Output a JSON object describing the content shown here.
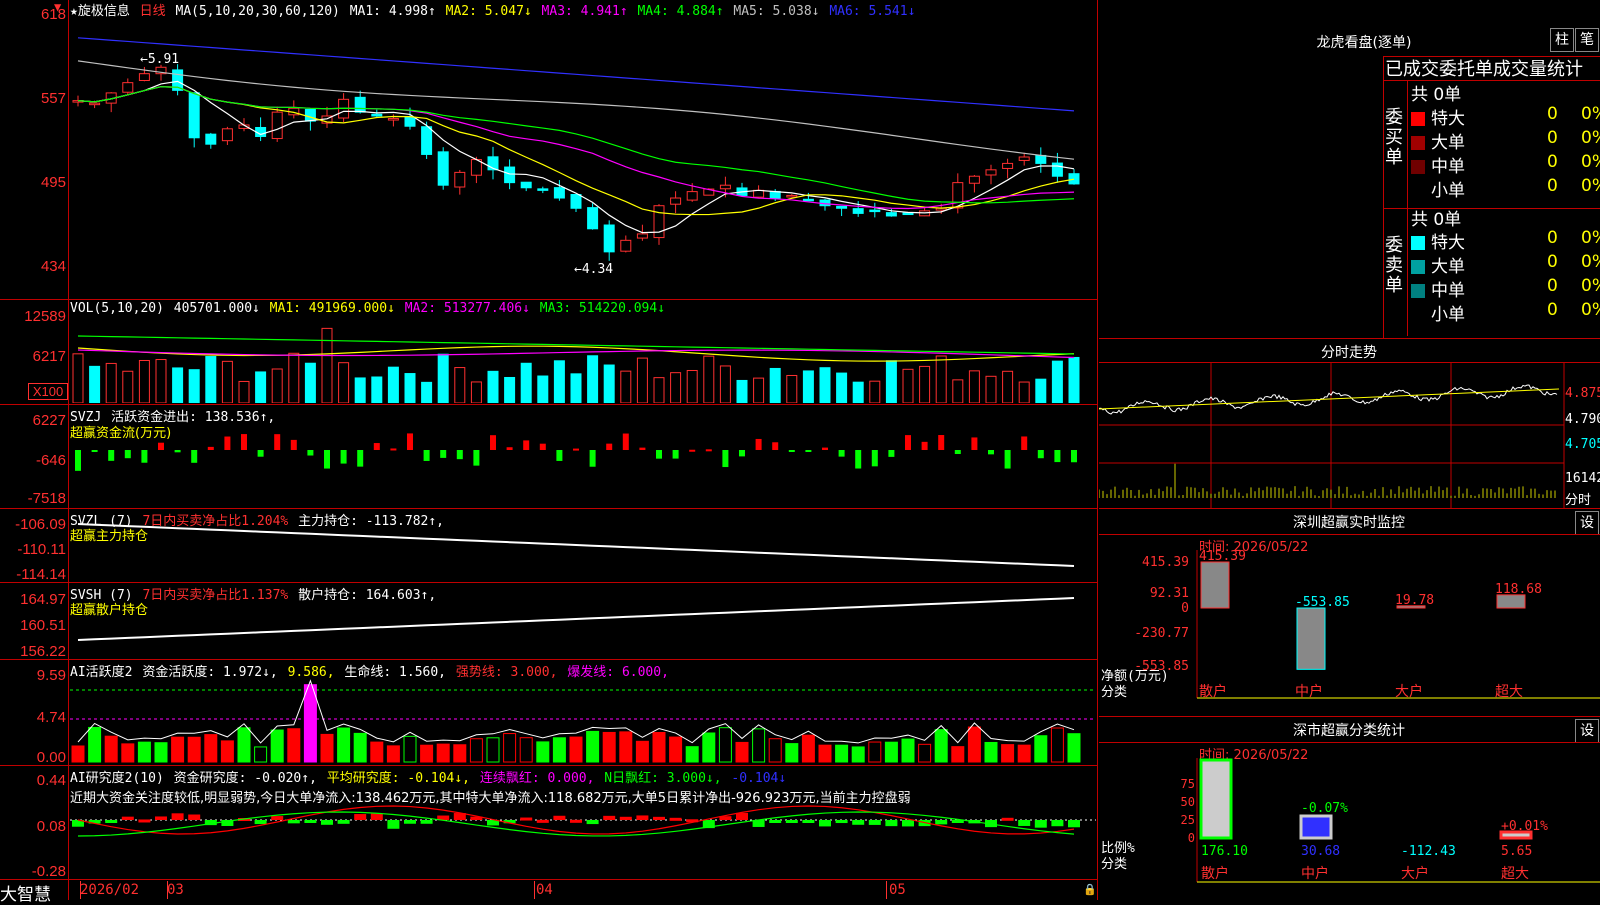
{
  "stock": {
    "name": "★旋极信息",
    "period": "日线",
    "ma_params": "MA(5,10,20,30,60,120)"
  },
  "price_header": [
    {
      "t": "MA1: 4.998↑",
      "c": "#ffffff"
    },
    {
      "t": "MA2: 5.047↓",
      "c": "#ffff00"
    },
    {
      "t": "MA3: 4.941↑",
      "c": "#ff00ff"
    },
    {
      "t": "MA4: 4.884↑",
      "c": "#00ff00"
    },
    {
      "t": "MA5: 5.038↓",
      "c": "#c0c0c0"
    },
    {
      "t": "MA6: 5.541↓",
      "c": "#0000ff"
    }
  ],
  "price_axis": [
    "618",
    "557",
    "495",
    "434"
  ],
  "price_marks": {
    "high": "5.91",
    "low": "4.34"
  },
  "vol_header": {
    "name": "VOL(5,10,20)",
    "value": "405701.000↓",
    "ma": [
      {
        "t": "MA1: 491969.000↓",
        "c": "#ffff00"
      },
      {
        "t": "MA2: 513277.406↓",
        "c": "#ff00ff"
      },
      {
        "t": "MA3: 514220.094↓",
        "c": "#00ff00"
      }
    ]
  },
  "vol_axis": [
    "12589",
    "6217",
    "X100"
  ],
  "svzj_header": {
    "name": "SVZJ",
    "label": "活跃资金进出: 138.536↑,",
    "sub": "超赢资金流(万元)"
  },
  "svzj_axis": [
    "6227",
    "-646",
    "-7518"
  ],
  "svzl_header": {
    "name": "SVZL (7)",
    "p1": "7日内买卖净占比1.204%",
    "p2": "主力持仓: -113.782↑,",
    "sub": "超赢主力持仓"
  },
  "svzl_axis": [
    "-106.09",
    "-110.11",
    "-114.14"
  ],
  "svsh_header": {
    "name": "SVSH (7)",
    "p1": "7日内买卖净占比1.137%",
    "p2": "散户持仓: 164.603↑,",
    "sub": "超赢散户持仓"
  },
  "svsh_axis": [
    "164.97",
    "160.51",
    "156.22"
  ],
  "ai1_header": {
    "name": "AI活跃度2",
    "p1": "资金活跃度: 1.972↓,",
    "p2": "9.586,",
    "p3": "生命线: 1.560,",
    "p4": "强势线: 3.000,",
    "p5": "爆发线: 6.000,"
  },
  "ai1_axis": [
    "9.59",
    "4.74",
    "0.00"
  ],
  "ai2_header": {
    "name": "AI研究度2(10)",
    "p1": "资金研究度: -0.020↑,",
    "p2": "平均研究度: -0.104↓,",
    "p3": "连续飘红: 0.000,",
    "p4": "N日飘红: 3.000↓,",
    "p5": "-0.104↓"
  },
  "ai2_text": "近期大资金关注度较低,明显弱势,今日大单净流入:138.462万元,其中特大单净流入:118.682万元,大单5日累计净出-926.923万元,当前主力控盘弱",
  "ai2_axis": [
    "0.44",
    "0.08",
    "-0.28"
  ],
  "bottom": {
    "brand": "大智慧",
    "dates": [
      "2026/02",
      "03",
      "04",
      "05"
    ]
  },
  "lhb": {
    "title": "龙虎看盘(逐单)",
    "btn1": "柱",
    "btn2": "笔",
    "tabs": [
      "已成交",
      "委托单",
      "成交量统计"
    ],
    "buy": {
      "side": "委买单",
      "total": "共 0单",
      "rows": [
        {
          "name": "特大",
          "v": "0",
          "p": "0%",
          "c": "#ff0000"
        },
        {
          "name": "大单",
          "v": "0",
          "p": "0%",
          "c": "#a00000"
        },
        {
          "name": "中单",
          "v": "0",
          "p": "0%",
          "c": "#700000"
        },
        {
          "name": "小单",
          "v": "0",
          "p": "0%",
          "c": ""
        }
      ]
    },
    "sell": {
      "side": "委卖单",
      "total": "共 0单",
      "rows": [
        {
          "name": "特大",
          "v": "0",
          "p": "0%",
          "c": "#00ffff"
        },
        {
          "name": "大单",
          "v": "0",
          "p": "0%",
          "c": "#00a0a0"
        },
        {
          "name": "中单",
          "v": "0",
          "p": "0%",
          "c": "#008080"
        },
        {
          "name": "小单",
          "v": "0",
          "p": "0%",
          "c": ""
        }
      ]
    }
  },
  "intraday": {
    "title": "分时走势",
    "axis": [
      "4.875",
      "4.790",
      "4.705"
    ],
    "vol": "16142",
    "vol_label": "分时"
  },
  "sz_monitor": {
    "title": "深圳超赢实时监控",
    "btn": "设",
    "time": "时间: 2026/05/22",
    "axis": [
      "415.39",
      "92.31",
      "0",
      "-230.77",
      "-553.85"
    ],
    "ylabel": "净额(万元)",
    "xlabel": "分类",
    "cats": [
      "散户",
      "中户",
      "大户",
      "超大"
    ],
    "values": [
      "415.39",
      "-553.85",
      "19.78",
      "118.68"
    ]
  },
  "sz_class": {
    "title": "深市超赢分类统计",
    "btn": "设",
    "time": "时间: 2026/05/22",
    "axis": [
      "75",
      "50",
      "25",
      "0"
    ],
    "ylabel": "比例%",
    "xlabel": "分类",
    "cats": [
      "散户",
      "中户",
      "大户",
      "超大"
    ],
    "bar_labels": [
      "-0.07%",
      "+0.01%"
    ],
    "values": [
      "176.10",
      "30.68",
      "-112.43",
      "5.65"
    ]
  },
  "chart_data": [
    {
      "type": "candlestick",
      "title": "旋极信息 日线",
      "ylim": [
        4.34,
        6.18
      ],
      "series": [
        {
          "name": "MA1",
          "last": 4.998
        },
        {
          "name": "MA2",
          "last": 5.047
        },
        {
          "name": "MA3",
          "last": 4.941
        },
        {
          "name": "MA4",
          "last": 4.884
        },
        {
          "name": "MA5",
          "last": 5.038
        },
        {
          "name": "MA6",
          "last": 5.541
        }
      ]
    },
    {
      "type": "bar",
      "title": "VOL(5,10,20)",
      "last": 405701.0
    },
    {
      "type": "bar",
      "title": "深圳超赢实时监控",
      "categories": [
        "散户",
        "中户",
        "大户",
        "超大"
      ],
      "values": [
        415.39,
        -553.85,
        19.78,
        118.68
      ]
    },
    {
      "type": "bar",
      "title": "深市超赢分类统计",
      "categories": [
        "散户",
        "中户",
        "大户",
        "超大"
      ],
      "values": [
        176.1,
        30.68,
        -112.43,
        5.65
      ]
    }
  ]
}
